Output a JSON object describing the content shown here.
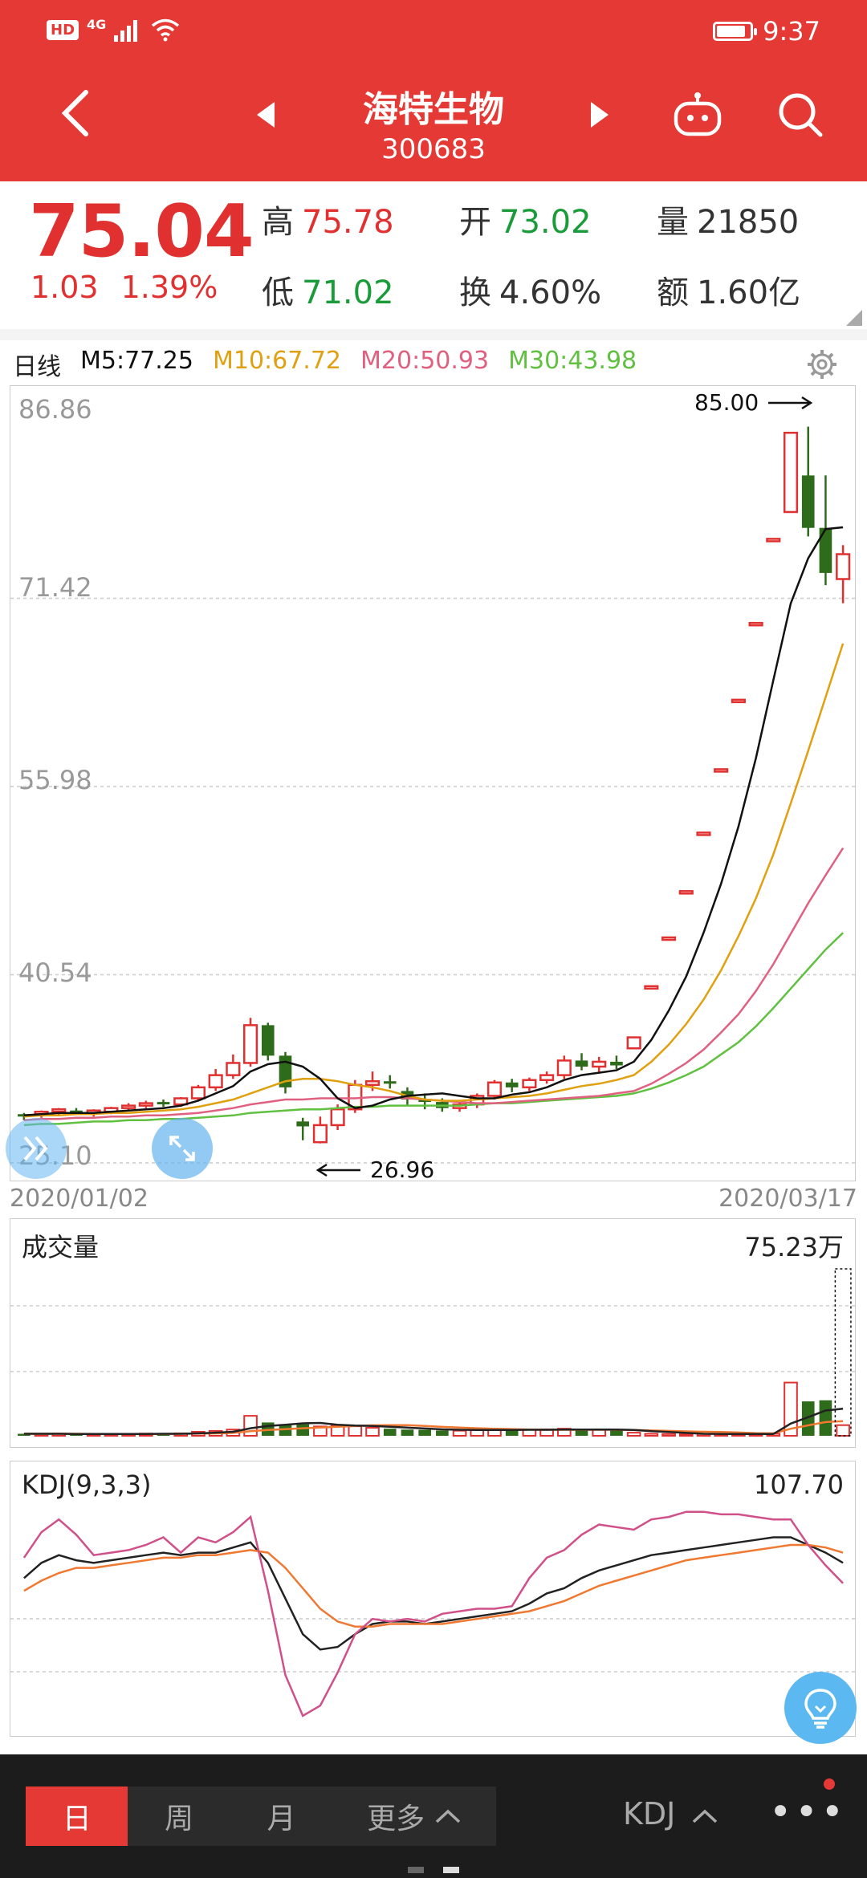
{
  "status": {
    "signal": "4G",
    "hd": "HD",
    "time": "9:37"
  },
  "header": {
    "title": "海特生物",
    "code": "300683"
  },
  "quote": {
    "price": "75.04",
    "change": "1.03",
    "change_pct": "1.39%",
    "high_label": "高",
    "high": "75.78",
    "low_label": "低",
    "low": "71.02",
    "open_label": "开",
    "open": "73.02",
    "turnover_label": "换",
    "turnover": "4.60%",
    "volume_label": "量",
    "volume": "21850",
    "amount_label": "额",
    "amount": "1.60亿"
  },
  "ma": {
    "period": "日线",
    "m5": "M5:77.25",
    "m10": "M10:67.72",
    "m20": "M20:50.93",
    "m30": "M30:43.98",
    "colors": {
      "m5": "#111111",
      "m10": "#e0a010",
      "m20": "#e06080",
      "m30": "#60c040"
    }
  },
  "chart_data": [
    {
      "type": "candlestick",
      "title": "日线",
      "y_ticks": [
        "86.86",
        "71.42",
        "55.98",
        "40.54",
        "25.10"
      ],
      "ylim": [
        25.1,
        86.86
      ],
      "x_start": "2020/01/02",
      "x_end": "2020/03/17",
      "max_annotation": "85.00",
      "min_annotation": "26.96",
      "candles": [
        [
          29.0,
          29.2,
          28.6,
          28.9
        ],
        [
          29.1,
          29.4,
          28.8,
          29.3
        ],
        [
          29.3,
          29.6,
          29.0,
          29.4
        ],
        [
          29.4,
          29.6,
          29.1,
          29.2
        ],
        [
          29.2,
          29.5,
          28.9,
          29.3
        ],
        [
          29.3,
          29.7,
          29.1,
          29.6
        ],
        [
          29.6,
          30.0,
          29.4,
          29.8
        ],
        [
          29.8,
          30.2,
          29.6,
          30.0
        ],
        [
          30.0,
          30.3,
          29.7,
          29.9
        ],
        [
          29.9,
          30.5,
          29.7,
          30.4
        ],
        [
          30.4,
          31.5,
          30.2,
          31.3
        ],
        [
          31.3,
          32.8,
          31.0,
          32.3
        ],
        [
          32.3,
          34.0,
          32.0,
          33.3
        ],
        [
          33.3,
          37.0,
          33.0,
          36.4
        ],
        [
          36.4,
          36.6,
          33.5,
          33.9
        ],
        [
          33.9,
          34.2,
          30.8,
          31.3
        ],
        [
          28.5,
          28.8,
          26.96,
          28.1
        ],
        [
          26.8,
          28.9,
          26.7,
          28.2
        ],
        [
          28.2,
          29.9,
          27.8,
          29.5
        ],
        [
          29.5,
          31.9,
          29.2,
          31.5
        ],
        [
          31.5,
          32.6,
          31.0,
          31.8
        ],
        [
          31.8,
          32.3,
          31.2,
          31.6
        ],
        [
          31.0,
          31.3,
          29.8,
          30.3
        ],
        [
          30.3,
          30.8,
          29.5,
          30.1
        ],
        [
          30.1,
          30.4,
          29.3,
          29.6
        ],
        [
          29.6,
          30.2,
          29.3,
          29.9
        ],
        [
          29.9,
          30.8,
          29.6,
          30.6
        ],
        [
          30.6,
          31.9,
          30.3,
          31.7
        ],
        [
          31.7,
          32.0,
          30.9,
          31.3
        ],
        [
          31.3,
          32.1,
          31.0,
          31.9
        ],
        [
          31.9,
          32.6,
          31.6,
          32.3
        ],
        [
          32.3,
          33.9,
          32.0,
          33.5
        ],
        [
          33.5,
          34.1,
          32.7,
          33.0
        ],
        [
          33.0,
          33.8,
          32.5,
          33.4
        ],
        [
          33.4,
          33.9,
          32.8,
          33.1
        ],
        [
          34.5,
          35.4,
          34.5,
          35.4
        ],
        [
          39.5,
          39.5,
          39.5,
          39.5
        ],
        [
          43.5,
          43.5,
          43.5,
          43.5
        ],
        [
          47.3,
          47.3,
          47.3,
          47.3
        ],
        [
          52.1,
          52.1,
          52.1,
          52.1
        ],
        [
          57.3,
          57.3,
          57.3,
          57.3
        ],
        [
          63.0,
          63.0,
          63.0,
          63.0
        ],
        [
          69.3,
          69.3,
          69.3,
          69.3
        ],
        [
          76.2,
          76.2,
          76.2,
          76.2
        ],
        [
          78.5,
          85.0,
          78.5,
          85.0
        ],
        [
          81.5,
          85.5,
          76.5,
          77.2
        ],
        [
          77.2,
          81.5,
          72.5,
          73.5
        ],
        [
          73.0,
          75.78,
          71.02,
          75.04
        ]
      ],
      "moving_averages": {
        "m5": [
          29.0,
          29.1,
          29.2,
          29.2,
          29.2,
          29.3,
          29.4,
          29.5,
          29.6,
          29.8,
          30.2,
          30.8,
          31.4,
          32.6,
          33.2,
          33.4,
          33.0,
          32.0,
          30.4,
          29.6,
          29.8,
          30.3,
          30.6,
          30.7,
          30.8,
          30.6,
          30.4,
          30.4,
          30.7,
          30.9,
          31.3,
          31.9,
          32.3,
          32.5,
          32.7,
          33.4,
          35.2,
          37.6,
          40.4,
          44.0,
          48.0,
          52.7,
          58.3,
          64.7,
          71.0,
          74.7,
          77.1,
          77.25
        ],
        "m10": [
          28.9,
          29.0,
          29.0,
          29.1,
          29.1,
          29.2,
          29.2,
          29.3,
          29.4,
          29.5,
          29.7,
          30.0,
          30.3,
          30.8,
          31.3,
          31.8,
          32.0,
          32.0,
          31.8,
          31.5,
          31.3,
          31.0,
          30.6,
          30.3,
          30.2,
          30.2,
          30.3,
          30.4,
          30.5,
          30.6,
          30.8,
          31.1,
          31.4,
          31.6,
          31.9,
          32.3,
          33.4,
          34.8,
          36.5,
          38.5,
          40.9,
          43.7,
          46.8,
          50.4,
          54.6,
          58.9,
          63.3,
          67.72
        ],
        "m20": [
          28.6,
          28.7,
          28.7,
          28.8,
          28.8,
          28.9,
          28.9,
          29.0,
          29.0,
          29.1,
          29.2,
          29.4,
          29.6,
          29.9,
          30.1,
          30.3,
          30.3,
          30.4,
          30.4,
          30.4,
          30.5,
          30.5,
          30.4,
          30.3,
          30.2,
          30.1,
          30.0,
          30.0,
          30.1,
          30.2,
          30.3,
          30.4,
          30.5,
          30.6,
          30.8,
          31.0,
          31.6,
          32.4,
          33.3,
          34.4,
          35.8,
          37.3,
          39.2,
          41.4,
          43.9,
          46.4,
          48.7,
          50.93
        ],
        "m30": [
          28.2,
          28.3,
          28.3,
          28.4,
          28.5,
          28.5,
          28.6,
          28.6,
          28.7,
          28.7,
          28.8,
          28.9,
          29.0,
          29.2,
          29.3,
          29.4,
          29.5,
          29.5,
          29.6,
          29.7,
          29.7,
          29.8,
          29.8,
          29.8,
          29.8,
          29.8,
          29.9,
          30.0,
          30.0,
          30.1,
          30.2,
          30.3,
          30.4,
          30.5,
          30.6,
          30.8,
          31.2,
          31.7,
          32.3,
          33.0,
          34.0,
          35.0,
          36.3,
          37.8,
          39.4,
          41.0,
          42.6,
          43.98
        ]
      }
    },
    {
      "type": "bar",
      "title": "成交量",
      "max_label": "75.23万",
      "ylim": [
        0,
        75.23
      ],
      "values": [
        0.9,
        0.8,
        1.0,
        0.7,
        0.6,
        0.8,
        0.9,
        1.0,
        0.9,
        1.1,
        1.8,
        2.2,
        2.8,
        9.0,
        6.0,
        4.8,
        5.2,
        4.2,
        4.6,
        4.3,
        3.6,
        3.2,
        2.8,
        2.7,
        2.4,
        2.3,
        2.6,
        2.9,
        2.5,
        2.7,
        2.9,
        3.2,
        2.8,
        2.7,
        2.6,
        1.4,
        0.9,
        0.8,
        0.7,
        0.8,
        0.9,
        0.7,
        0.8,
        0.9,
        24.0,
        15.5,
        16.0,
        4.8
      ],
      "ma_lines": {
        "vma5": [
          0.9,
          0.9,
          0.9,
          0.8,
          0.8,
          0.8,
          0.8,
          0.8,
          0.9,
          0.9,
          1.1,
          1.4,
          1.8,
          3.4,
          4.4,
          5.0,
          5.6,
          5.8,
          5.0,
          4.6,
          4.4,
          4.1,
          3.7,
          3.3,
          2.9,
          2.7,
          2.6,
          2.6,
          2.6,
          2.7,
          2.7,
          2.8,
          2.8,
          2.8,
          2.8,
          2.6,
          2.1,
          1.7,
          1.3,
          0.9,
          0.8,
          0.8,
          0.8,
          0.8,
          5.5,
          8.4,
          11.4,
          12.2
        ],
        "vma10": [
          0.9,
          0.9,
          0.9,
          0.9,
          0.8,
          0.8,
          0.8,
          0.8,
          0.8,
          0.9,
          1.0,
          1.1,
          1.3,
          2.1,
          2.6,
          3.0,
          3.4,
          3.7,
          4.1,
          4.4,
          4.7,
          4.8,
          4.8,
          4.4,
          4.0,
          3.7,
          3.4,
          3.2,
          3.0,
          2.8,
          2.7,
          2.7,
          2.7,
          2.7,
          2.7,
          2.6,
          2.4,
          2.2,
          2.0,
          1.8,
          1.7,
          1.5,
          1.2,
          1.1,
          3.2,
          4.7,
          6.2,
          6.6
        ]
      }
    },
    {
      "type": "line",
      "title": "KDJ(9,3,3)",
      "max_label": "107.70",
      "series": [
        {
          "name": "K",
          "color": "#222222",
          "values": [
            70,
            76,
            79,
            77,
            76,
            77,
            78,
            79,
            80,
            79,
            80,
            80,
            82,
            84,
            76,
            62,
            48,
            42,
            43,
            48,
            52,
            53,
            53,
            52,
            53,
            54,
            55,
            56,
            57,
            60,
            64,
            66,
            70,
            73,
            75,
            77,
            79,
            80,
            81,
            82,
            83,
            84,
            85,
            86,
            86,
            83,
            80,
            76
          ]
        },
        {
          "name": "D",
          "color": "#f07830",
          "values": [
            65,
            69,
            72,
            74,
            74,
            75,
            76,
            77,
            78,
            78,
            79,
            79,
            80,
            81,
            80,
            74,
            66,
            58,
            53,
            51,
            51,
            52,
            52,
            52,
            52,
            53,
            54,
            55,
            56,
            57,
            59,
            61,
            64,
            67,
            69,
            71,
            73,
            75,
            77,
            78,
            79,
            80,
            81,
            82,
            83,
            83,
            82,
            80
          ]
        },
        {
          "name": "J",
          "color": "#d0508a",
          "values": [
            78,
            88,
            93,
            87,
            79,
            80,
            81,
            83,
            86,
            80,
            86,
            84,
            88,
            94,
            65,
            32,
            16,
            20,
            33,
            48,
            54,
            53,
            54,
            53,
            56,
            57,
            58,
            58,
            59,
            70,
            78,
            81,
            87,
            91,
            90,
            89,
            93,
            94,
            96,
            96,
            95,
            95,
            94,
            93,
            93,
            83,
            75,
            68
          ]
        }
      ]
    }
  ],
  "bottom_tabs": {
    "day": "日",
    "week": "周",
    "month": "月",
    "more": "更多"
  },
  "indicator_select": "KDJ"
}
